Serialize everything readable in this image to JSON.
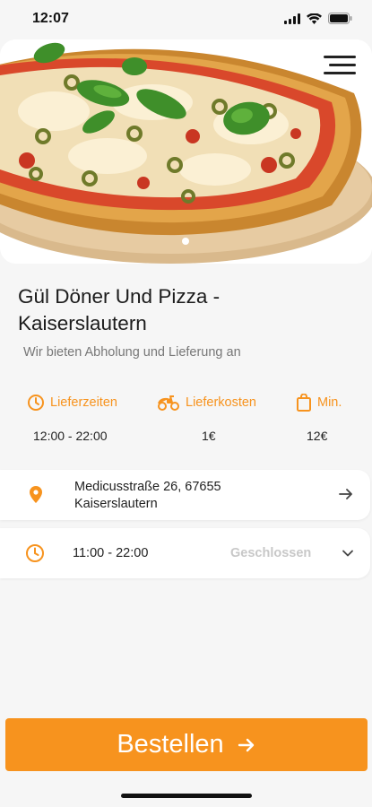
{
  "status_bar": {
    "time": "12:07"
  },
  "restaurant": {
    "name": "Gül Döner Und Pizza - Kaiserslautern",
    "tagline": "Wir bieten Abholung und Lieferung an"
  },
  "info": {
    "delivery_times": {
      "label": "Lieferzeiten",
      "value": "12:00 - 22:00"
    },
    "delivery_cost": {
      "label": "Lieferkosten",
      "value": "1€"
    },
    "minimum": {
      "label": "Min.",
      "value": "12€"
    }
  },
  "address": {
    "line1": "Medicusstraße 26, 67655",
    "line2": "Kaiserslautern"
  },
  "hours": {
    "range": "11:00 - 22:00",
    "status": "Geschlossen"
  },
  "order_button": {
    "label": "Bestellen"
  },
  "carousel": {
    "slide_count": 1,
    "active_index": 0
  },
  "colors": {
    "accent": "#f7931e",
    "background": "#f6f6f6",
    "card": "#ffffff"
  }
}
